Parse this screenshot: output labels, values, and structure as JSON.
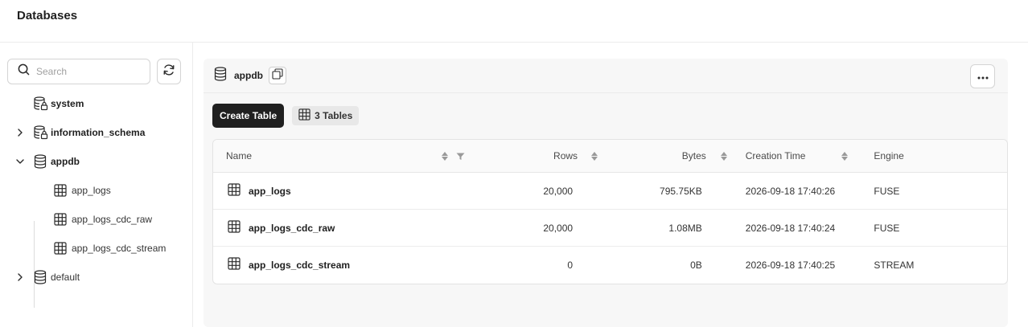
{
  "header": {
    "title": "Databases"
  },
  "sidebar": {
    "search_placeholder": "Search",
    "databases": [
      {
        "name": "system",
        "expandable": false,
        "locked": true
      },
      {
        "name": "information_schema",
        "expandable": true,
        "expanded": false,
        "locked": true
      },
      {
        "name": "appdb",
        "expandable": true,
        "expanded": true,
        "locked": false
      },
      {
        "name": "default",
        "expandable": true,
        "expanded": false,
        "locked": false
      }
    ],
    "appdb_tables": [
      "app_logs",
      "app_logs_cdc_raw",
      "app_logs_cdc_stream"
    ]
  },
  "main": {
    "db_name": "appdb",
    "create_label": "Create Table",
    "tables_count_label": "3 Tables",
    "columns": [
      "Name",
      "Rows",
      "Bytes",
      "Creation Time",
      "Engine"
    ],
    "rows": [
      {
        "name": "app_logs",
        "rows": "20,000",
        "bytes": "795.75KB",
        "created": "2026-09-18 17:40:26",
        "engine": "FUSE"
      },
      {
        "name": "app_logs_cdc_raw",
        "rows": "20,000",
        "bytes": "1.08MB",
        "created": "2026-09-18 17:40:24",
        "engine": "FUSE"
      },
      {
        "name": "app_logs_cdc_stream",
        "rows": "0",
        "bytes": "0B",
        "created": "2026-09-18 17:40:25",
        "engine": "STREAM"
      }
    ]
  },
  "icons": {
    "search": "search-icon",
    "refresh": "refresh-icon",
    "database": "database-icon",
    "table": "table-grid-icon",
    "copy": "copy-icon",
    "more": "more-horizontal-icon",
    "chevron_right": "chevron-right-icon",
    "chevron_down": "chevron-down-icon"
  }
}
